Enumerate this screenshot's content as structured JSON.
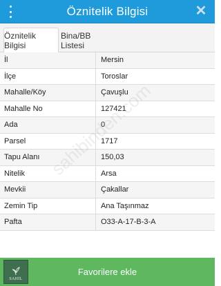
{
  "header": {
    "title": "Öznitelik Bilgisi",
    "menu_icon": "vertical-dots-icon",
    "close_icon": "close-icon"
  },
  "tabs": [
    {
      "label": "Öznitelik Bilgisi",
      "active": true
    },
    {
      "label": "Bina/BB Listesi",
      "active": false
    }
  ],
  "attributes": [
    {
      "key": "İl",
      "value": "Mersin"
    },
    {
      "key": "İlçe",
      "value": "Toroslar"
    },
    {
      "key": "Mahalle/Köy",
      "value": "Çavuşlu"
    },
    {
      "key": "Mahalle No",
      "value": "127421"
    },
    {
      "key": "Ada",
      "value": "0"
    },
    {
      "key": "Parsel",
      "value": "1717"
    },
    {
      "key": "Tapu Alanı",
      "value": "150,03"
    },
    {
      "key": "Nitelik",
      "value": "Arsa"
    },
    {
      "key": "Mevkii",
      "value": "Çakallar"
    },
    {
      "key": "Zemin Tip",
      "value": "Ana Taşınmaz"
    },
    {
      "key": "Pafta",
      "value": "O33-A-17-B-3-A"
    }
  ],
  "watermark": "sahibinden.com",
  "footer": {
    "favorite_label": "Favorilere ekle",
    "logo_text": "SAHİL"
  },
  "colors": {
    "header_bg": "#1f9bdc",
    "favorite_bg": "#5fb860",
    "logo_bg": "#3f6f4e"
  }
}
